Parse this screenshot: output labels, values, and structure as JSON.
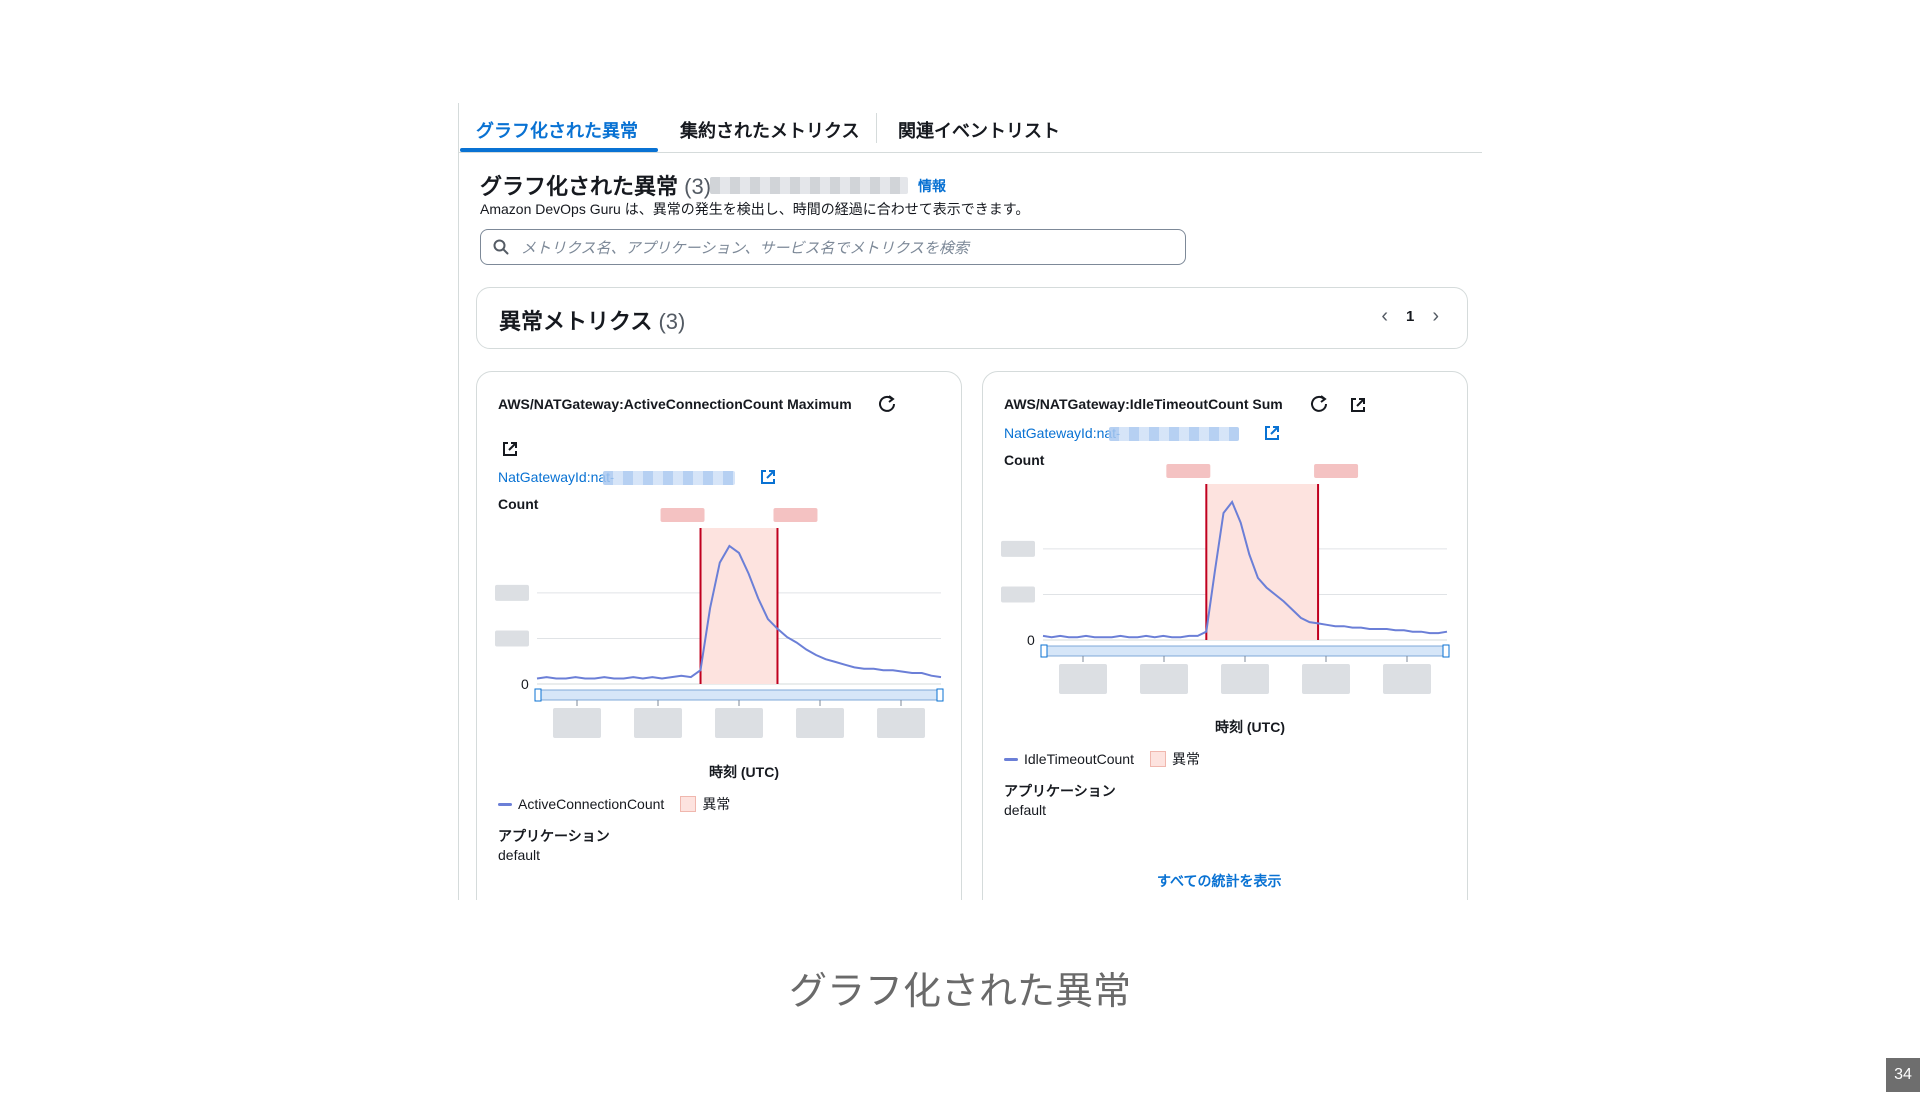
{
  "tabs": [
    {
      "label": "グラフ化された異常",
      "active": true
    },
    {
      "label": "集約されたメトリクス",
      "active": false
    },
    {
      "label": "関連イベントリスト",
      "active": false
    }
  ],
  "header": {
    "title": "グラフ化された異常",
    "count": "(3)",
    "info": "情報",
    "description": "Amazon DevOps Guru は、異常の発生を検出し、時間の経過に合わせて表示できます。"
  },
  "search": {
    "placeholder": "メトリクス名、アプリケーション、サービス名でメトリクスを検索"
  },
  "metrics": {
    "title": "異常メトリクス",
    "count": "(3)",
    "page": "1"
  },
  "cards": [
    {
      "title": "AWS/NATGateway:ActiveConnectionCount Maximum",
      "link": "NatGatewayId:nat-",
      "y_label": "Count",
      "y_zero": "0",
      "x_label": "時刻 (UTC)",
      "legend_series": "ActiveConnectionCount",
      "legend_anomaly": "異常",
      "app_label": "アプリケーション",
      "app_value": "default"
    },
    {
      "title": "AWS/NATGateway:IdleTimeoutCount Sum",
      "link": "NatGatewayId:nat-",
      "y_label": "Count",
      "y_zero": "0",
      "x_label": "時刻 (UTC)",
      "legend_series": "IdleTimeoutCount",
      "legend_anomaly": "異常",
      "app_label": "アプリケーション",
      "app_value": "default",
      "stats_link": "すべての統計を表示"
    }
  ],
  "chart_data": [
    {
      "type": "line",
      "series": [
        {
          "name": "ActiveConnectionCount",
          "values": [
            0.04,
            0.05,
            0.04,
            0.04,
            0.05,
            0.04,
            0.04,
            0.05,
            0.04,
            0.04,
            0.05,
            0.04,
            0.05,
            0.04,
            0.05,
            0.06,
            0.05,
            0.1,
            0.55,
            0.88,
            1.0,
            0.95,
            0.8,
            0.62,
            0.47,
            0.4,
            0.34,
            0.3,
            0.25,
            0.21,
            0.18,
            0.16,
            0.14,
            0.12,
            0.11,
            0.11,
            0.1,
            0.1,
            0.09,
            0.08,
            0.08,
            0.06,
            0.05
          ]
        }
      ],
      "anomaly_range": [
        17,
        25
      ],
      "color": "#6b7fd7",
      "anomaly_color": "#fde3df",
      "anomaly_line_color": "#c0001f"
    },
    {
      "type": "line",
      "series": [
        {
          "name": "IdleTimeoutCount",
          "values": [
            0.03,
            0.02,
            0.03,
            0.02,
            0.02,
            0.03,
            0.02,
            0.02,
            0.02,
            0.03,
            0.02,
            0.02,
            0.03,
            0.02,
            0.03,
            0.02,
            0.02,
            0.03,
            0.03,
            0.06,
            0.5,
            0.92,
            1.0,
            0.85,
            0.62,
            0.45,
            0.38,
            0.33,
            0.28,
            0.22,
            0.16,
            0.13,
            0.12,
            0.11,
            0.1,
            0.1,
            0.09,
            0.09,
            0.08,
            0.08,
            0.08,
            0.07,
            0.07,
            0.06,
            0.06,
            0.05,
            0.05,
            0.06
          ]
        }
      ],
      "anomaly_range": [
        19,
        32
      ],
      "color": "#6b7fd7",
      "anomaly_color": "#fde3df",
      "anomaly_line_color": "#c0001f"
    }
  ],
  "slide": {
    "caption": "グラフ化された異常",
    "page_number": "34"
  }
}
